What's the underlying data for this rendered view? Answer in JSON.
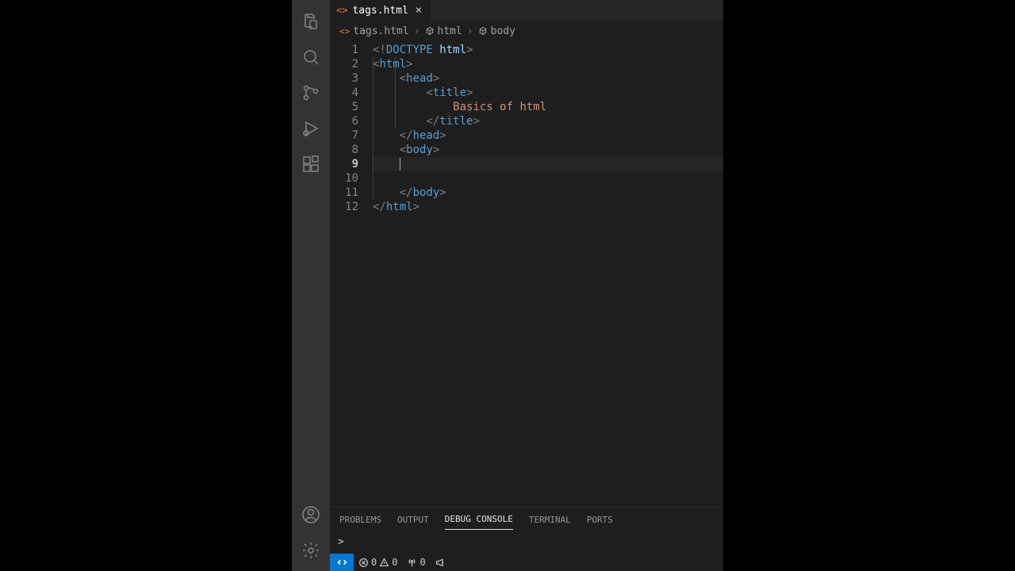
{
  "tab": {
    "filename": "tags.html"
  },
  "breadcrumbs": {
    "file": "tags.html",
    "p1": "html",
    "p2": "body"
  },
  "code": {
    "lines": [
      {
        "n": "1",
        "indent": 0,
        "tokens": [
          [
            "punc",
            "<!"
          ],
          [
            "doctype",
            "DOCTYPE "
          ],
          [
            "doctype-kw",
            "html"
          ],
          [
            "punc",
            ">"
          ]
        ]
      },
      {
        "n": "2",
        "indent": 0,
        "tokens": [
          [
            "punc",
            "<"
          ],
          [
            "tag",
            "html"
          ],
          [
            "punc",
            ">"
          ]
        ]
      },
      {
        "n": "3",
        "indent": 1,
        "tokens": [
          [
            "punc",
            "<"
          ],
          [
            "tag",
            "head"
          ],
          [
            "punc",
            ">"
          ]
        ]
      },
      {
        "n": "4",
        "indent": 2,
        "tokens": [
          [
            "punc",
            "<"
          ],
          [
            "tag",
            "title"
          ],
          [
            "punc",
            ">"
          ]
        ]
      },
      {
        "n": "5",
        "indent": 3,
        "tokens": [
          [
            "text",
            "Basics of html"
          ]
        ]
      },
      {
        "n": "6",
        "indent": 2,
        "tokens": [
          [
            "punc",
            "</"
          ],
          [
            "tag",
            "title"
          ],
          [
            "punc",
            ">"
          ]
        ]
      },
      {
        "n": "7",
        "indent": 1,
        "tokens": [
          [
            "punc",
            "</"
          ],
          [
            "tag",
            "head"
          ],
          [
            "punc",
            ">"
          ]
        ]
      },
      {
        "n": "8",
        "indent": 1,
        "tokens": [
          [
            "punc",
            "<"
          ],
          [
            "tag",
            "body"
          ],
          [
            "punc",
            ">"
          ]
        ]
      },
      {
        "n": "9",
        "indent": 1,
        "active": true,
        "cursor": true,
        "tokens": []
      },
      {
        "n": "10",
        "indent": 0,
        "tokens": []
      },
      {
        "n": "11",
        "indent": 1,
        "tokens": [
          [
            "punc",
            "</"
          ],
          [
            "tag",
            "body"
          ],
          [
            "punc",
            ">"
          ]
        ]
      },
      {
        "n": "12",
        "indent": 0,
        "tokens": [
          [
            "punc",
            "</"
          ],
          [
            "tag",
            "html"
          ],
          [
            "punc",
            ">"
          ]
        ]
      }
    ]
  },
  "panel": {
    "tabs": {
      "problems": "PROBLEMS",
      "output": "OUTPUT",
      "debug": "DEBUG CONSOLE",
      "terminal": "TERMINAL",
      "ports": "PORTS"
    },
    "prompt": ">"
  },
  "status": {
    "errors": "0",
    "warnings": "0",
    "ports": "0"
  }
}
